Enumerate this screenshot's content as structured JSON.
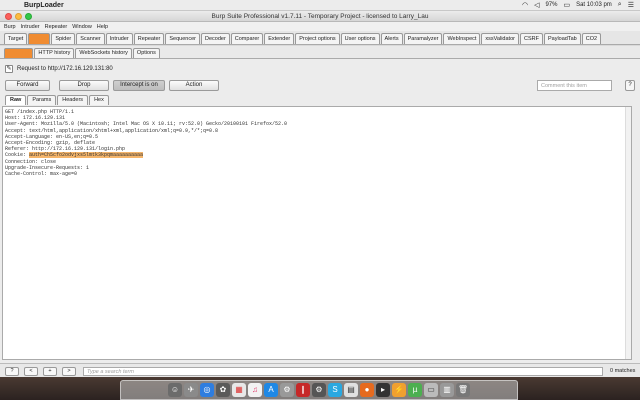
{
  "menubar": {
    "app_name": "BurpLoader",
    "battery": "97%",
    "clock": "Sat 10:03 pm"
  },
  "window": {
    "title": "Burp Suite Professional v1.7.11 - Temporary Project - licensed to Larry_Lau"
  },
  "app_menu": [
    "Burp",
    "Intruder",
    "Repeater",
    "Window",
    "Help"
  ],
  "main_tabs": [
    "Target",
    "Proxy",
    "Spider",
    "Scanner",
    "Intruder",
    "Repeater",
    "Sequencer",
    "Decoder",
    "Comparer",
    "Extender",
    "Project options",
    "User options",
    "Alerts",
    "Paramalyzer",
    "WebInspect",
    "xssValidator",
    "CSRF",
    "PayloadTab",
    "CO2"
  ],
  "active_main_tab": "Proxy",
  "sub_tabs": [
    "Intercept",
    "HTTP history",
    "WebSockets history",
    "Options"
  ],
  "active_sub_tab": "Intercept",
  "intercept": {
    "request_label": "Request to http://172.16.129.131:80",
    "forward_label": "Forward",
    "drop_label": "Drop",
    "intercept_label": "Intercept is on",
    "action_label": "Action",
    "comment_placeholder": "Comment this item",
    "help_label": "?"
  },
  "view_tabs": [
    "Raw",
    "Params",
    "Headers",
    "Hex"
  ],
  "active_view_tab": "Raw",
  "request": {
    "line1": "GET /index.php HTTP/1.1",
    "line2": "Host: 172.16.129.131",
    "line3": "User-Agent: Mozilla/5.0 (Macintosh; Intel Mac OS X 10.11; rv:52.0) Gecko/20100101 Firefox/52.0",
    "line4": "Accept: text/html,application/xhtml+xml,application/xml;q=0.9,*/*;q=0.8",
    "line5": "Accept-Language: en-US,en;q=0.5",
    "line6": "Accept-Encoding: gzip, deflate",
    "line7": "Referer: http://172.16.129.131/login.php",
    "cookie_prefix": "Cookie: ",
    "cookie_value": "auth=Ch5cfo2odvjxs5lmtk3kpqmaaaaaaaaaa",
    "line9": "Connection: close",
    "line10": "Upgrade-Insecure-Requests: 1",
    "line11": "Cache-Control: max-age=0"
  },
  "search": {
    "help_label": "?",
    "prev_label": "<",
    "add_label": "+",
    "next_label": ">",
    "placeholder": "Type a search term",
    "matches": "0 matches"
  },
  "colors": {
    "accent": "#f08c32",
    "highlight": "#f5b56a"
  }
}
